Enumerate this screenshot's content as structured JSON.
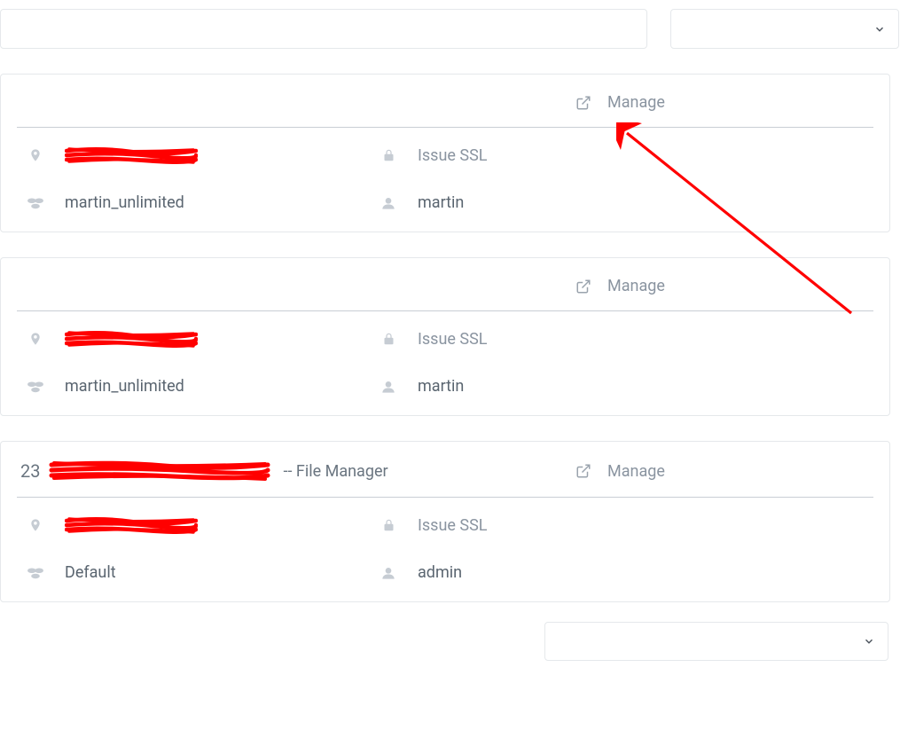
{
  "search": {
    "placeholder": ""
  },
  "dropdown": {
    "selected": ""
  },
  "footerDropdown": {
    "selected": ""
  },
  "cards": [
    {
      "headerTitle": "",
      "headerSuffix": "",
      "manage": "Manage",
      "location": "",
      "issueSsl": "Issue SSL",
      "package": "martin_unlimited",
      "user": "martin"
    },
    {
      "headerTitle": "",
      "headerSuffix": "",
      "manage": "Manage",
      "location": "",
      "issueSsl": "Issue SSL",
      "package": "martin_unlimited",
      "user": "martin"
    },
    {
      "headerTitle": "23",
      "headerSuffix": "-- File Manager",
      "manage": "Manage",
      "location": "",
      "issueSsl": "Issue SSL",
      "package": "Default",
      "user": "admin"
    }
  ]
}
